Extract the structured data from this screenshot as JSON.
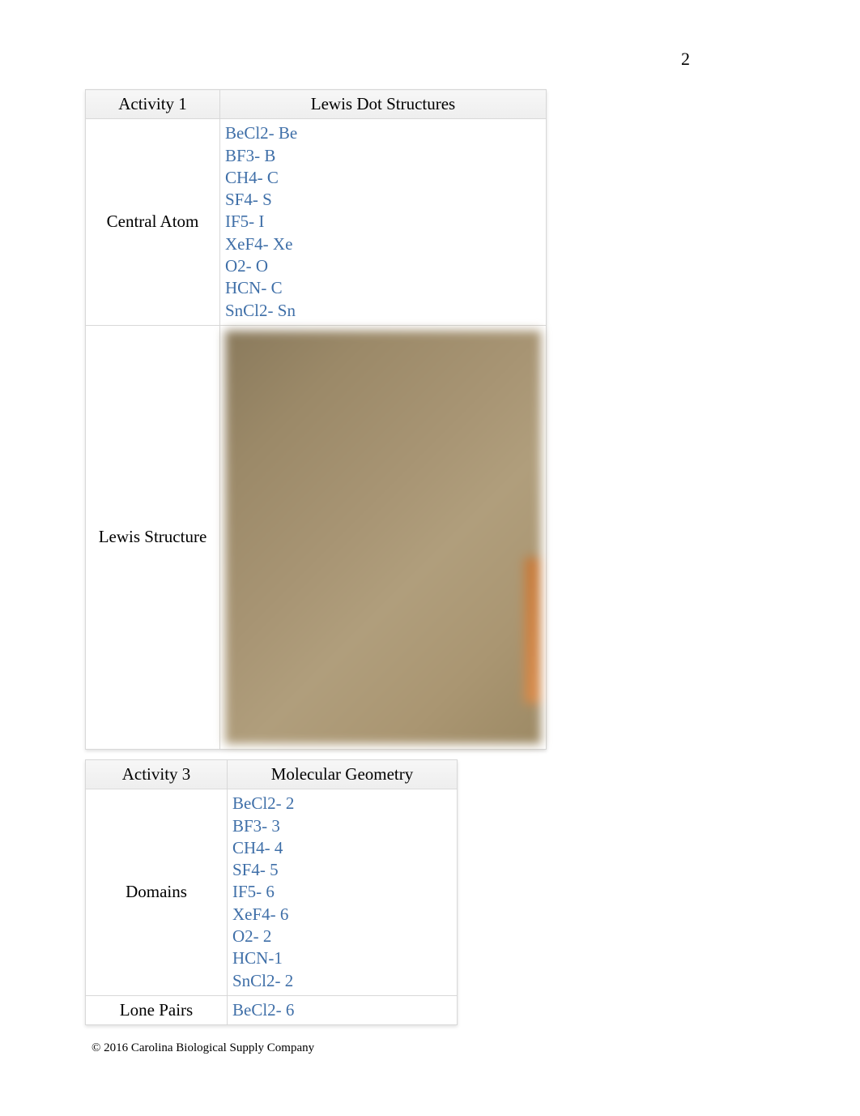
{
  "page_number": "2",
  "table1": {
    "header_left": "Activity 1",
    "header_right": "Lewis Dot Structures",
    "row1_label": "Central Atom",
    "row1_items": [
      "BeCl2- Be",
      "BF3- B",
      "CH4- C",
      "SF4- S",
      "IF5- I",
      "XeF4- Xe",
      "O2- O",
      "HCN- C",
      "SnCl2- Sn"
    ],
    "row2_label": "Lewis Structure"
  },
  "table2": {
    "header_left": "Activity 3",
    "header_right": "Molecular Geometry",
    "row1_label": "Domains",
    "row1_items": [
      "BeCl2- 2",
      "BF3- 3",
      "CH4- 4",
      "SF4- 5",
      "IF5- 6",
      "XeF4- 6",
      "O2- 2",
      "HCN-1",
      "SnCl2- 2"
    ],
    "row2_label": "Lone Pairs",
    "row2_items": [
      "BeCl2- 6"
    ]
  },
  "footer": "© 2016 Carolina Biological Supply Company"
}
